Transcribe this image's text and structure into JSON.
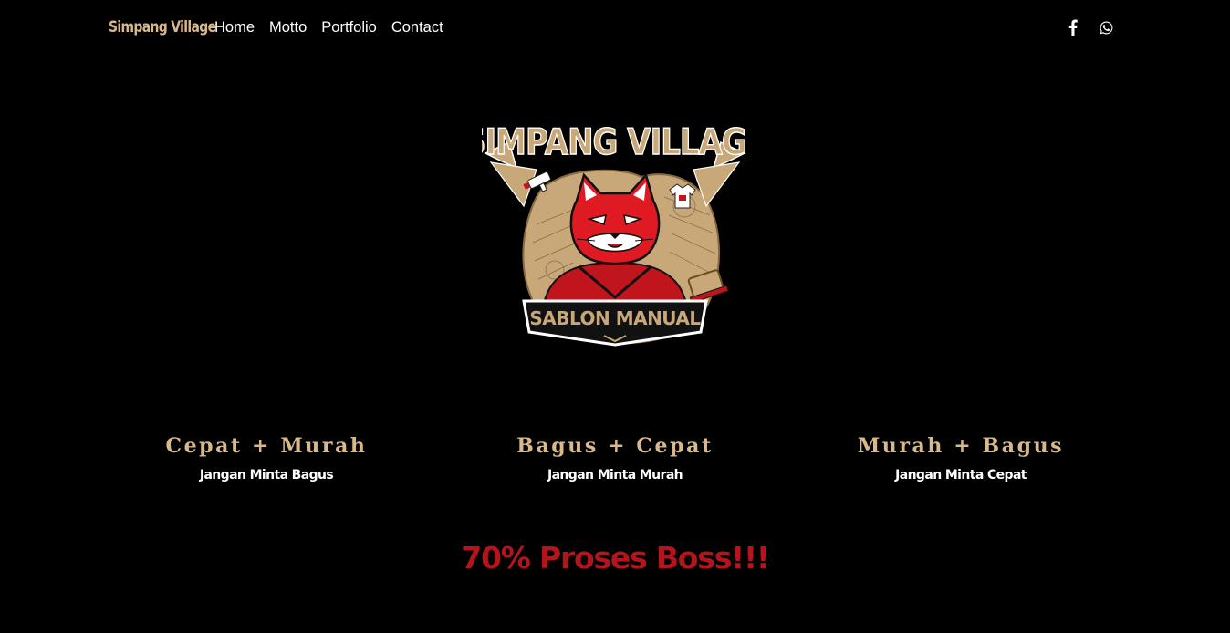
{
  "nav": {
    "brand": "Simpang Village",
    "links": [
      "Home",
      "Motto",
      "Portfolio",
      "Contact"
    ],
    "socials": [
      {
        "icon": "facebook-icon"
      },
      {
        "icon": "whatsapp-icon"
      }
    ]
  },
  "logo": {
    "title": "SIMPANG VILLAGE",
    "banner": "SABLON MANUAL"
  },
  "mottos": [
    {
      "title": "Cepat + Murah",
      "subtitle": "Jangan Minta Bagus"
    },
    {
      "title": "Bagus + Cepat",
      "subtitle": "Jangan Minta Murah"
    },
    {
      "title": "Murah + Bagus",
      "subtitle": "Jangan Minta Cepat"
    }
  ],
  "progress_text": "70% Proses Boss!!!",
  "colors": {
    "background": "#000000",
    "accent_gold": "#d9b98a",
    "accent_red": "#b4141c",
    "text": "#ffffff"
  }
}
